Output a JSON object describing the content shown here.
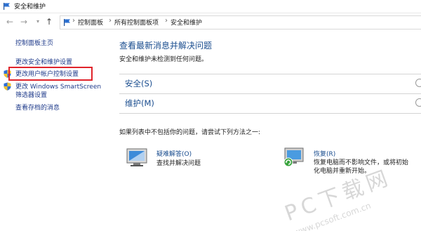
{
  "window": {
    "title": "安全和维护"
  },
  "addressbar": {
    "breadcrumbs": [
      "控制面板",
      "所有控制面板项",
      "安全和维护"
    ],
    "separator": "›"
  },
  "sidebar": {
    "home": "控制面板主页",
    "links": [
      "更改安全和维护设置",
      "更改用户帐户控制设置",
      "更改 Windows SmartScreen",
      "筛选器设置",
      "查看存档的消息"
    ]
  },
  "main": {
    "title": "查看最新消息并解决问题",
    "subtitle": "安全和维护未检测到任何问题。",
    "sections": [
      {
        "label": "安全(S)"
      },
      {
        "label": "维护(M)"
      }
    ],
    "prompt": "如果列表中不包括你的问题，请尝试下列方法之一:",
    "tools": [
      {
        "title": "疑难解答(O)",
        "desc": [
          "查找并解决问题"
        ]
      },
      {
        "title": "恢复(R)",
        "desc": [
          "恢复电脑而不影响文件，或将初始",
          "化电脑并重新开始。"
        ]
      }
    ]
  },
  "watermark": {
    "text": "PC下载网",
    "url": "www.pcsoft.com.cn"
  },
  "colors": {
    "link": "#1a4d8f",
    "highlight": "#e0242b",
    "divider": "#d4d4d4"
  }
}
